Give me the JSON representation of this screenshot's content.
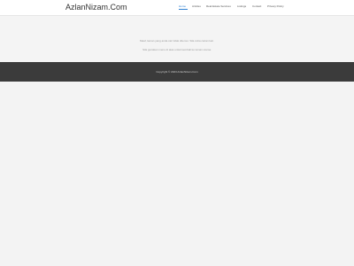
{
  "header": {
    "site_title": "AzlanNizam.Com",
    "nav": [
      {
        "label": "Home",
        "active": true
      },
      {
        "label": "Articles",
        "active": false
      },
      {
        "label": "Real Estate Services",
        "active": false
      },
      {
        "label": "Listings",
        "active": false
      },
      {
        "label": "Contact",
        "active": false
      },
      {
        "label": "Privacy Policy",
        "active": false
      }
    ]
  },
  "main": {
    "line1": "Maaf, laman yang anda cari tidak ditemui. Sila cuba carian lain.",
    "line2": "Sila gunakan menu di atas untuk kembali ke laman utama."
  },
  "footer": {
    "copyright": "Copyright © 2023 AzlanNizam.Com"
  },
  "colors": {
    "accent": "#2e7fd1",
    "footer_bg": "#3b3b3b",
    "page_bg": "#f3f3f3"
  }
}
